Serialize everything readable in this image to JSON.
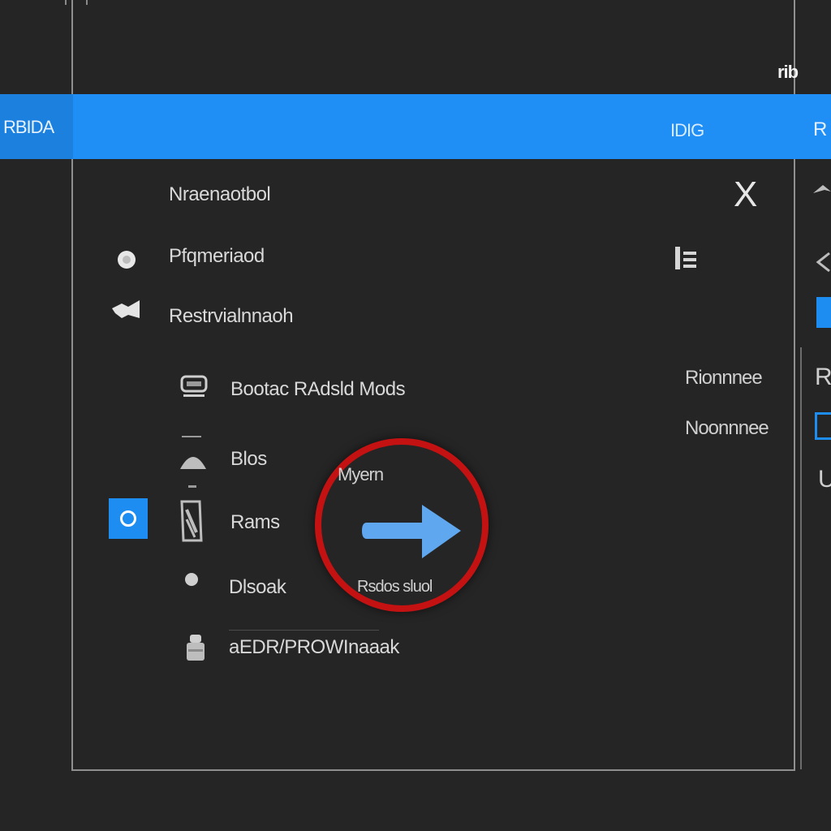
{
  "window": {
    "corner_label": "rib"
  },
  "header_bar": {
    "left_label": "RBIDA",
    "center_label": "IDIG",
    "edge_label": "R",
    "accent_color": "#1f8ef5"
  },
  "menu": {
    "title": "Nraenaotbol",
    "close_label": "X",
    "items": [
      {
        "label": "Pfqmeriaod",
        "icon": "dot-icon"
      },
      {
        "label": "Restrvialnnaoh",
        "icon": "flag-icon"
      },
      {
        "label": "Bootac RAdsld Mods",
        "icon": "drive-icon"
      },
      {
        "label": "Blos",
        "icon": "eject-icon"
      },
      {
        "label": "Rams",
        "icon": "document-icon",
        "selected": true
      },
      {
        "label": "Dlsoak",
        "icon": "dot-icon"
      },
      {
        "label": "aEDR/PROWInaaak",
        "icon": "stamp-icon"
      }
    ]
  },
  "right_panel": {
    "labels": [
      "Rionnnee",
      "Noonnnee"
    ],
    "edge_glyphs": [
      "R",
      "U"
    ]
  },
  "cursor_highlight": {
    "top_text": "Myern",
    "bottom_text": "Rsdos sluol",
    "ring_color": "#c41212",
    "arrow_color": "#5fa8f0"
  }
}
